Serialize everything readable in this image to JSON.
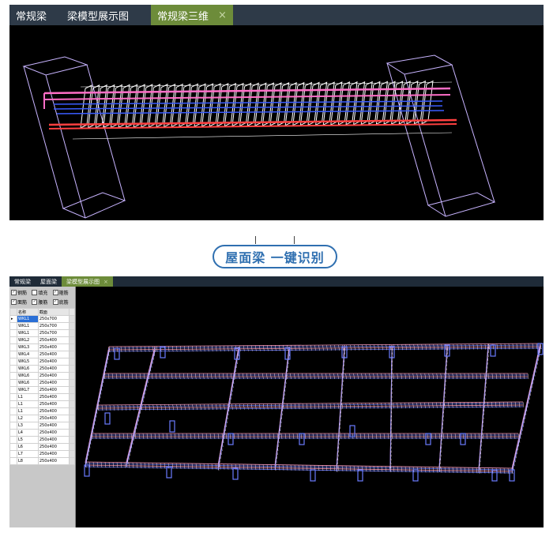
{
  "top_window": {
    "tabs": [
      {
        "label": "常规梁",
        "active": false
      },
      {
        "label": "梁模型展示图",
        "active": false
      },
      {
        "label": "常规梁三维",
        "active": true
      }
    ],
    "close_symbol": "×"
  },
  "callout": {
    "text": "屋面梁 一键识别"
  },
  "bottom_window": {
    "tabs": [
      {
        "label": "常规梁",
        "active": false
      },
      {
        "label": "屋面梁",
        "active": false
      },
      {
        "label": "梁模型展示图",
        "active": true
      }
    ],
    "close_symbol": "×",
    "checkboxes": [
      {
        "label": "钢筋",
        "checked": true
      },
      {
        "label": "填充",
        "checked": false
      },
      {
        "label": "箍筋",
        "checked": true
      },
      {
        "label": "面筋",
        "checked": true
      },
      {
        "label": "腰筋",
        "checked": true
      },
      {
        "label": "底筋",
        "checked": true
      }
    ],
    "table": {
      "headers": [
        "名称",
        "截面"
      ],
      "rows": [
        [
          "WKL1",
          "250x700"
        ],
        [
          "WKL1",
          "250x700"
        ],
        [
          "WKL1",
          "250x700"
        ],
        [
          "WKL2",
          "250x400"
        ],
        [
          "WKL3",
          "250x400"
        ],
        [
          "WKL4",
          "250x400"
        ],
        [
          "WKL5",
          "250x400"
        ],
        [
          "WKL6",
          "250x400"
        ],
        [
          "WKL6",
          "250x400"
        ],
        [
          "WKL6",
          "250x400"
        ],
        [
          "WKL7",
          "250x400"
        ],
        [
          "L1",
          "250x400"
        ],
        [
          "L1",
          "250x400"
        ],
        [
          "L1",
          "250x400"
        ],
        [
          "L2",
          "250x400"
        ],
        [
          "L3",
          "250x400"
        ],
        [
          "L4",
          "250x400"
        ],
        [
          "L5",
          "250x400"
        ],
        [
          "L6",
          "250x400"
        ],
        [
          "L7",
          "250x400"
        ],
        [
          "L8",
          "250x400"
        ]
      ]
    }
  },
  "colors": {
    "top_rebar": "#ff6ec7",
    "side_rebar": "#3a5cff",
    "bottom_rebar": "#ff4040",
    "stirrup": "#ffffff",
    "column_outline": "#c8b4ff",
    "mesh_pink": "#ff9ec8",
    "mesh_blue": "#6a7cff"
  }
}
